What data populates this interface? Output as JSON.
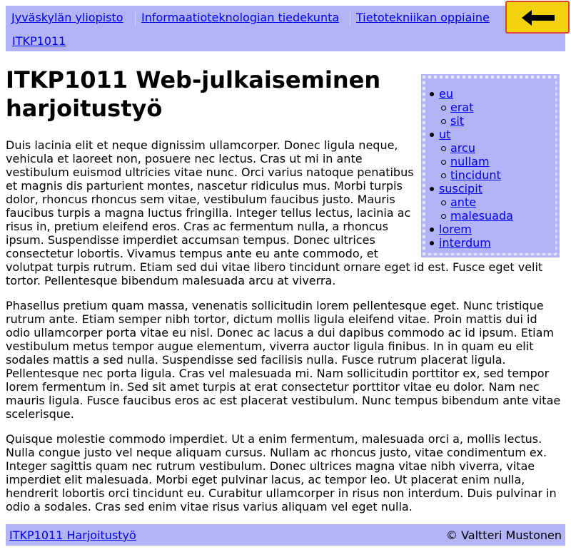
{
  "breadcrumbs": [
    {
      "label": "Jyväskylän yliopisto"
    },
    {
      "label": "Informaatioteknologian tiedekunta"
    },
    {
      "label": "Tietotekniikan oppiaine"
    }
  ],
  "course_link": "ITKP1011",
  "back_button_icon": "arrow-left-icon",
  "title_line1": "ITKP1011 Web-julkaiseminen",
  "title_line2": "harjoitustyö",
  "toc": {
    "items": [
      {
        "label": "eu",
        "level": 1
      },
      {
        "label": "erat",
        "level": 2
      },
      {
        "label": "sit",
        "level": 2
      },
      {
        "label": "ut",
        "level": 1
      },
      {
        "label": "arcu",
        "level": 2
      },
      {
        "label": "nullam",
        "level": 2
      },
      {
        "label": "tincidunt",
        "level": 2
      },
      {
        "label": "suscipit",
        "level": 1
      },
      {
        "label": "ante",
        "level": 2
      },
      {
        "label": "malesuada",
        "level": 2
      },
      {
        "label": "lorem",
        "level": 1
      },
      {
        "label": "interdum",
        "level": 1
      }
    ]
  },
  "paragraphs": [
    [
      "Duis lacinia elit et neque dignissim ullamcorper. Donec ligula neque,",
      "vehicula et laoreet non, posuere nec lectus. Cras ut mi in ante",
      "vestibulum euismod ultricies vitae nunc. Orci varius natoque penatibus",
      "et magnis dis parturient montes, nascetur ridiculus mus. Morbi turpis",
      "dolor, rhoncus rhoncus sem vitae, vestibulum faucibus justo. Mauris",
      "faucibus turpis a magna luctus fringilla. Integer tellus lectus, lacinia ac",
      "risus in, pretium eleifend eros. Cras ac fermentum nulla, a rhoncus",
      "ipsum. Suspendisse imperdiet accumsan tempus. Donec ultrices",
      "consectetur lobortis. Vivamus tempus ante eu ante commodo, et",
      "volutpat turpis rutrum. Etiam sed dui vitae libero tincidunt ornare eget id est. Fusce eget velit",
      "tortor. Pellentesque bibendum malesuada arcu at viverra."
    ],
    [
      "Phasellus pretium quam massa, venenatis sollicitudin lorem pellentesque eget. Nunc tristique",
      "rutrum ante. Etiam semper nibh tortor, dictum mollis ligula eleifend vitae. Proin mattis dui id",
      "odio ullamcorper porta vitae eu nisl. Donec ac lacus a dui dapibus commodo ac id ipsum. Etiam",
      "vestibulum metus tempor augue elementum, viverra auctor ligula finibus. In in quam eu elit",
      "sodales mattis a sed nulla. Suspendisse sed facilisis nulla. Fusce rutrum placerat ligula.",
      "Pellentesque nec porta ligula. Cras vel malesuada mi. Nam sollicitudin porttitor ex, sed tempor",
      "lorem fermentum in. Sed sit amet turpis at erat consectetur porttitor vitae eu dolor. Nam nec",
      "mauris ligula. Fusce faucibus eros ac est placerat vestibulum. Nunc tempus bibendum ante vitae",
      "scelerisque."
    ],
    [
      "Quisque molestie commodo imperdiet. Ut a enim fermentum, malesuada orci a, mollis lectus.",
      "Nulla congue justo vel neque aliquam cursus. Nullam ac rhoncus justo, vitae condimentum ex.",
      "Integer sagittis quam nec rutrum vestibulum. Donec ultrices magna vitae nibh viverra, vitae",
      "imperdiet elit malesuada. Morbi eget pulvinar lacus, ac tempor leo. Ut placerat enim nulla,",
      "hendrerit lobortis orci tincidunt eu. Curabitur ullamcorper in risus non interdum. Duis pulvinar in",
      "odio a sodales. Cras sed enim vitae risus varius aliquam vel eget nulla."
    ]
  ],
  "footer": {
    "link": "ITKP1011 Harjoitustyö",
    "copyright": "© Valtteri Mustonen"
  },
  "colors": {
    "nav_background": "#b3b3f7",
    "link": "#0000ee",
    "back_button": "#f2d20c",
    "back_button_border": "#e0432b"
  }
}
